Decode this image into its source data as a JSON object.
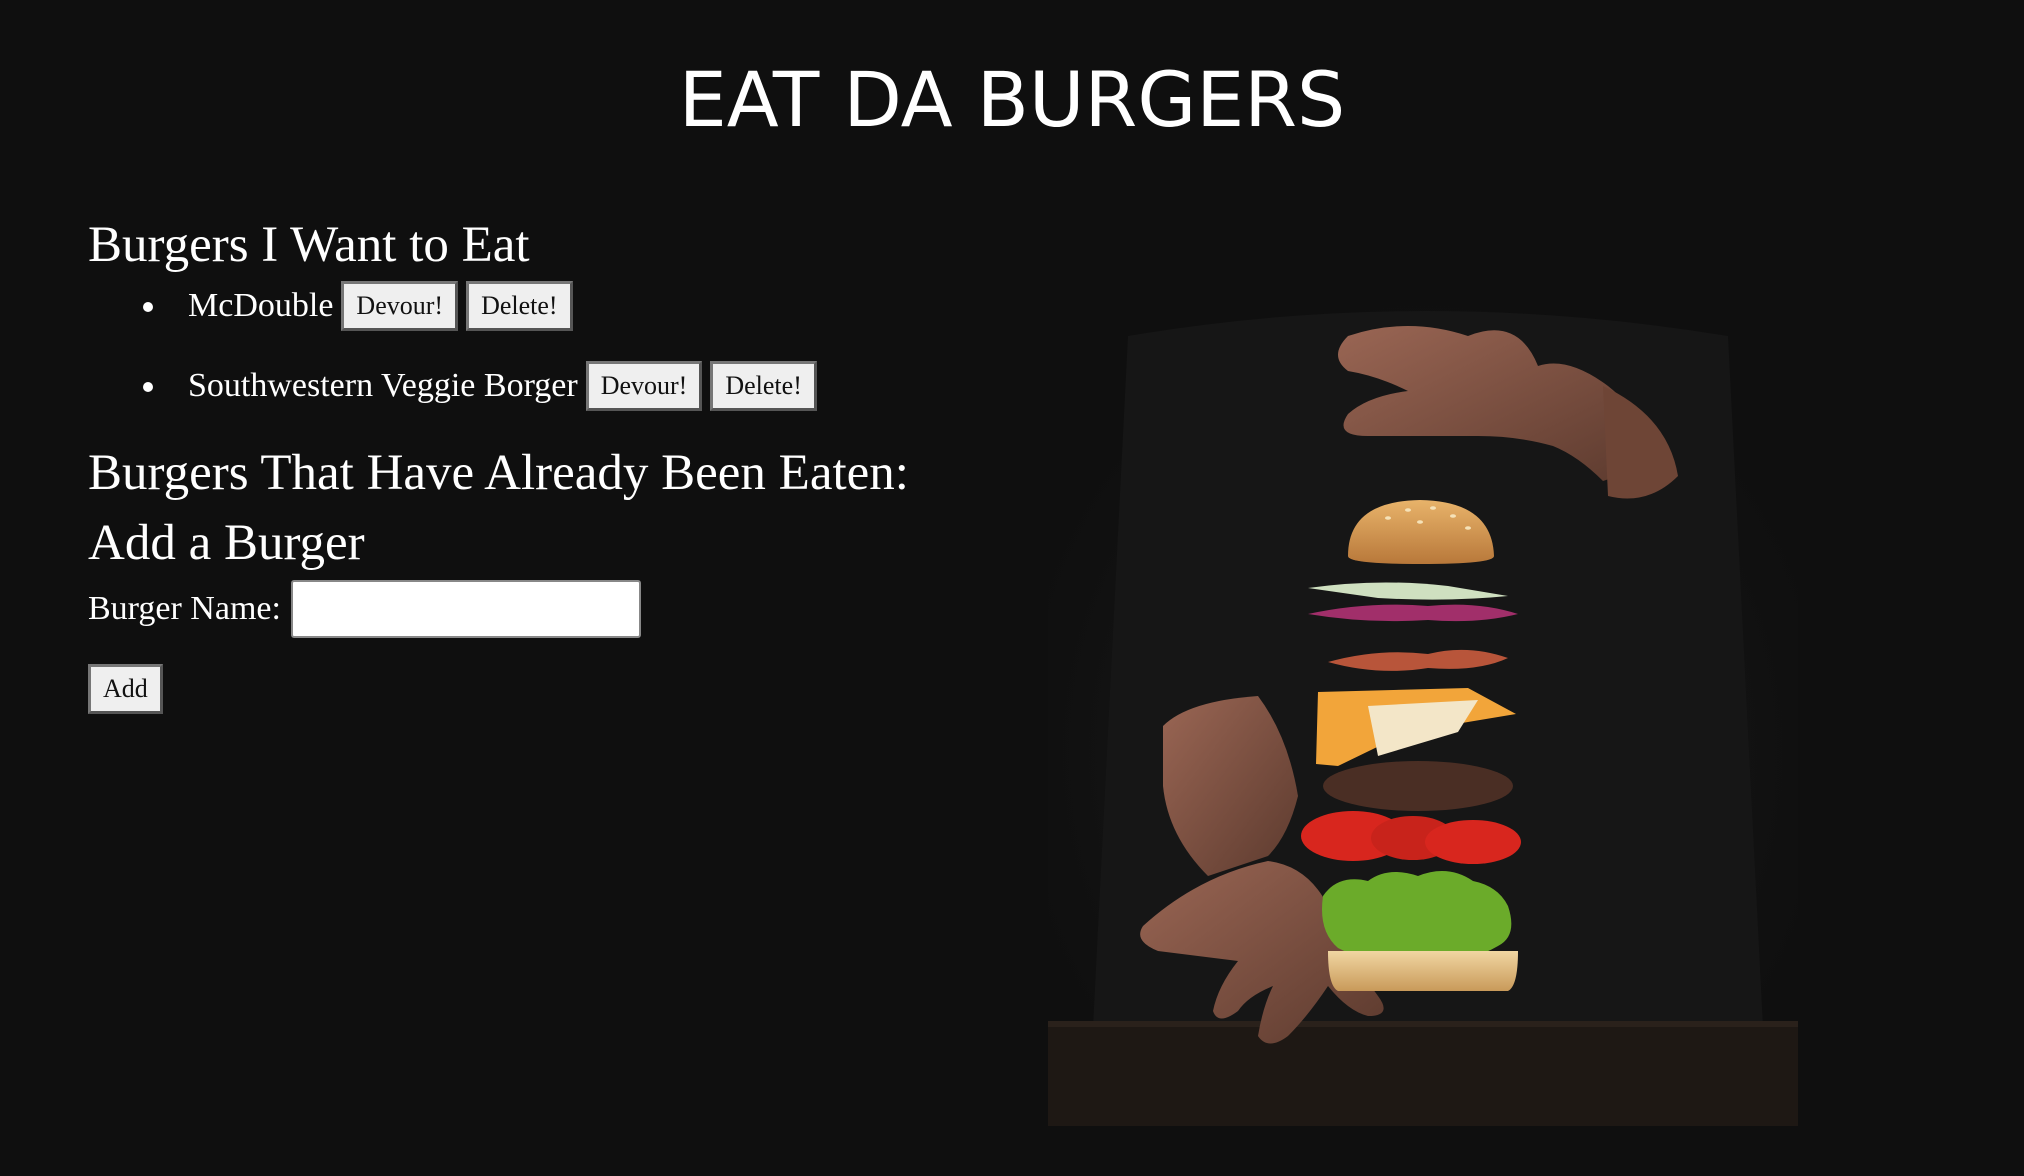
{
  "header": {
    "title": "EAT DA BURGERS"
  },
  "to_eat": {
    "heading": "Burgers I Want to Eat",
    "items": [
      {
        "name": "McDouble",
        "devour_label": "Devour!",
        "delete_label": "Delete!"
      },
      {
        "name": "Southwestern Veggie Borger",
        "devour_label": "Devour!",
        "delete_label": "Delete!"
      }
    ]
  },
  "eaten": {
    "heading": "Burgers That Have Already Been Eaten:"
  },
  "add_form": {
    "heading": "Add a Burger",
    "name_label": "Burger Name:",
    "name_value": "",
    "add_label": "Add"
  },
  "hero": {
    "icon": "floating-burger-photo",
    "colors": {
      "background": "#0f0f0f",
      "bun": "#d9a15c",
      "cheese": "#f2a53a",
      "patty": "#4a2e24",
      "tomato": "#d8261e",
      "lettuce": "#6bab2a",
      "skin": "#8b5a48"
    }
  }
}
